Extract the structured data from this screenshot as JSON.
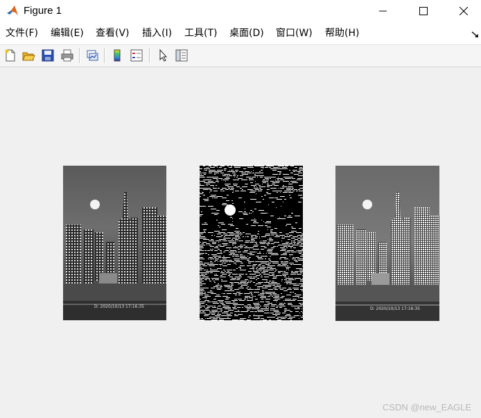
{
  "window": {
    "title": "Figure 1",
    "controls": [
      "minimize",
      "maximize",
      "close"
    ]
  },
  "menu": {
    "items": [
      {
        "label": "文件(F)"
      },
      {
        "label": "编辑(E)"
      },
      {
        "label": "查看(V)"
      },
      {
        "label": "插入(I)"
      },
      {
        "label": "工具(T)"
      },
      {
        "label": "桌面(D)"
      },
      {
        "label": "窗口(W)"
      },
      {
        "label": "帮助(H)"
      }
    ]
  },
  "toolbar": {
    "icons": [
      "new-figure-icon",
      "open-file-icon",
      "save-icon",
      "print-icon",
      "link-plot-icon",
      "colorbar-icon",
      "legend-icon",
      "select-pointer-icon",
      "property-inspector-icon"
    ]
  },
  "figure": {
    "images": [
      {
        "name": "grayscale-city-image",
        "stamp_text": "D: 2020/10/13 17:16:35"
      },
      {
        "name": "binary-threshold-image"
      },
      {
        "name": "filtered-city-image",
        "stamp_text": "D: 2020/10/13 17:16:35"
      }
    ]
  },
  "watermark": "CSDN @new_EAGLE"
}
